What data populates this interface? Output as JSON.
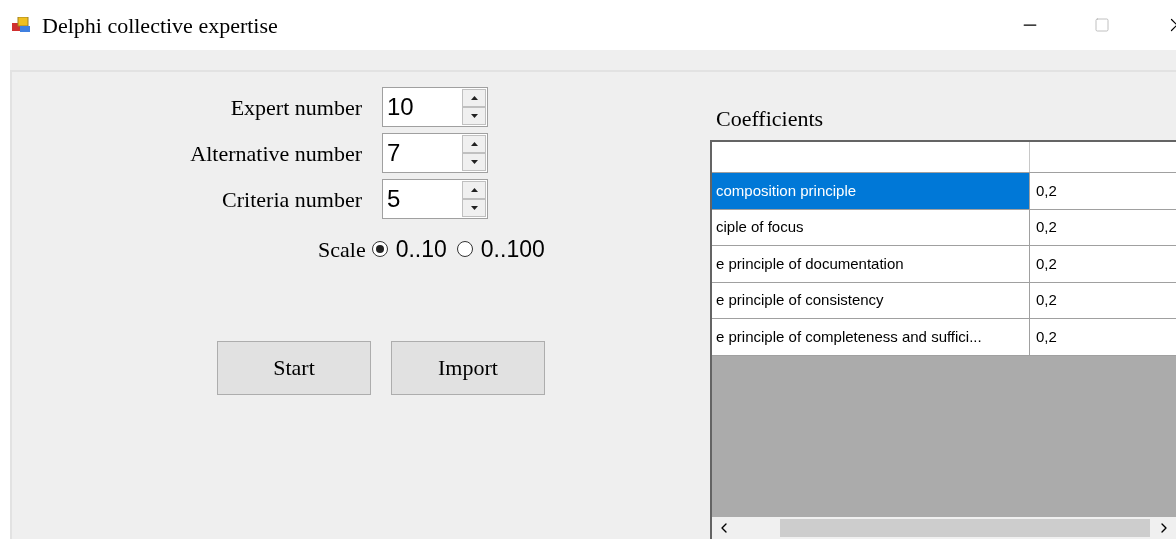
{
  "window": {
    "title": "Delphi collective expertise"
  },
  "spinners": [
    {
      "label": "Expert number",
      "value": "10"
    },
    {
      "label": "Alternative number",
      "value": "7"
    },
    {
      "label": "Criteria number",
      "value": "5"
    }
  ],
  "scale": {
    "label": "Scale",
    "options": [
      {
        "label": "0..10",
        "selected": true
      },
      {
        "label": "0..100",
        "selected": false
      }
    ]
  },
  "buttons": [
    "Start",
    "Import"
  ],
  "coefficients": {
    "title": "Coefficients",
    "rows": [
      {
        "name": "composition principle",
        "value": "0,2",
        "selected": true
      },
      {
        "name": "ciple of focus",
        "value": "0,2",
        "selected": false
      },
      {
        "name": "e principle of documentation",
        "value": "0,2",
        "selected": false
      },
      {
        "name": "e principle of consistency",
        "value": "0,2",
        "selected": false
      },
      {
        "name": "e principle of completeness and suffici...",
        "value": "0,2",
        "selected": false
      }
    ]
  }
}
